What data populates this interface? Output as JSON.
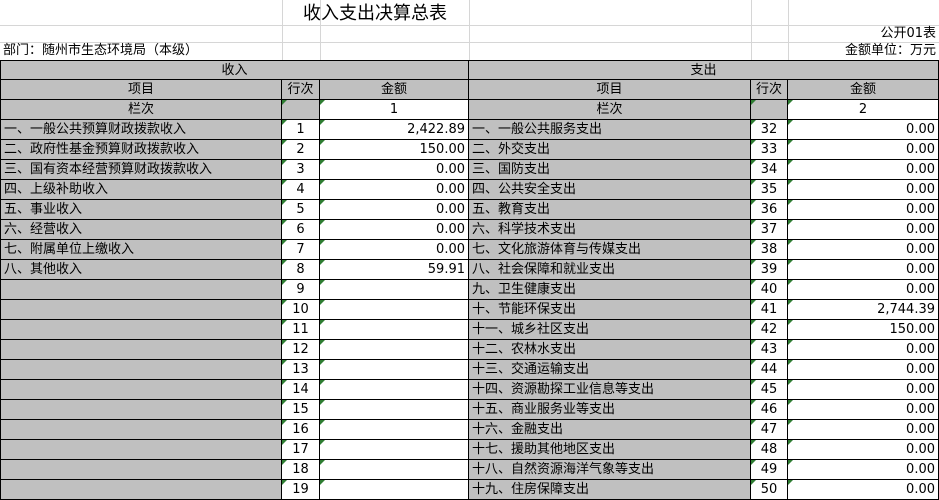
{
  "title": "收入支出决算总表",
  "form_no": "公开01表",
  "department": "部门：随州市生态环境局（本级）",
  "unit": "金额单位：万元",
  "income": {
    "header": "收入",
    "col_item": "项目",
    "col_row": "行次",
    "col_amount": "金额",
    "col_index_label": "栏次",
    "col_index_value": "1"
  },
  "expense": {
    "header": "支出",
    "col_item": "项目",
    "col_row": "行次",
    "col_amount": "金额",
    "col_index_label": "栏次",
    "col_index_value": "2"
  },
  "rows": [
    {
      "in_item": "一、一般公共预算财政拨款收入",
      "in_no": "1",
      "in_amt": "2,422.89",
      "ex_item": "一、一般公共服务支出",
      "ex_no": "32",
      "ex_amt": "0.00"
    },
    {
      "in_item": "二、政府性基金预算财政拨款收入",
      "in_no": "2",
      "in_amt": "150.00",
      "ex_item": "二、外交支出",
      "ex_no": "33",
      "ex_amt": "0.00"
    },
    {
      "in_item": "三、国有资本经营预算财政拨款收入",
      "in_no": "3",
      "in_amt": "0.00",
      "ex_item": "三、国防支出",
      "ex_no": "34",
      "ex_amt": "0.00"
    },
    {
      "in_item": "四、上级补助收入",
      "in_no": "4",
      "in_amt": "0.00",
      "ex_item": "四、公共安全支出",
      "ex_no": "35",
      "ex_amt": "0.00"
    },
    {
      "in_item": "五、事业收入",
      "in_no": "5",
      "in_amt": "0.00",
      "ex_item": "五、教育支出",
      "ex_no": "36",
      "ex_amt": "0.00"
    },
    {
      "in_item": "六、经营收入",
      "in_no": "6",
      "in_amt": "0.00",
      "ex_item": "六、科学技术支出",
      "ex_no": "37",
      "ex_amt": "0.00"
    },
    {
      "in_item": "七、附属单位上缴收入",
      "in_no": "7",
      "in_amt": "0.00",
      "ex_item": "七、文化旅游体育与传媒支出",
      "ex_no": "38",
      "ex_amt": "0.00"
    },
    {
      "in_item": "八、其他收入",
      "in_no": "8",
      "in_amt": "59.91",
      "ex_item": "八、社会保障和就业支出",
      "ex_no": "39",
      "ex_amt": "0.00"
    },
    {
      "in_item": "",
      "in_no": "9",
      "in_amt": "",
      "ex_item": "九、卫生健康支出",
      "ex_no": "40",
      "ex_amt": "0.00"
    },
    {
      "in_item": "",
      "in_no": "10",
      "in_amt": "",
      "ex_item": "十、节能环保支出",
      "ex_no": "41",
      "ex_amt": "2,744.39"
    },
    {
      "in_item": "",
      "in_no": "11",
      "in_amt": "",
      "ex_item": "十一、城乡社区支出",
      "ex_no": "42",
      "ex_amt": "150.00"
    },
    {
      "in_item": "",
      "in_no": "12",
      "in_amt": "",
      "ex_item": "十二、农林水支出",
      "ex_no": "43",
      "ex_amt": "0.00"
    },
    {
      "in_item": "",
      "in_no": "13",
      "in_amt": "",
      "ex_item": "十三、交通运输支出",
      "ex_no": "44",
      "ex_amt": "0.00"
    },
    {
      "in_item": "",
      "in_no": "14",
      "in_amt": "",
      "ex_item": "十四、资源勘探工业信息等支出",
      "ex_no": "45",
      "ex_amt": "0.00"
    },
    {
      "in_item": "",
      "in_no": "15",
      "in_amt": "",
      "ex_item": "十五、商业服务业等支出",
      "ex_no": "46",
      "ex_amt": "0.00"
    },
    {
      "in_item": "",
      "in_no": "16",
      "in_amt": "",
      "ex_item": "十六、金融支出",
      "ex_no": "47",
      "ex_amt": "0.00"
    },
    {
      "in_item": "",
      "in_no": "17",
      "in_amt": "",
      "ex_item": "十七、援助其他地区支出",
      "ex_no": "48",
      "ex_amt": "0.00"
    },
    {
      "in_item": "",
      "in_no": "18",
      "in_amt": "",
      "ex_item": "十八、自然资源海洋气象等支出",
      "ex_no": "49",
      "ex_amt": "0.00"
    },
    {
      "in_item": "",
      "in_no": "19",
      "in_amt": "",
      "ex_item": "十九、住房保障支出",
      "ex_no": "50",
      "ex_amt": "0.00"
    }
  ]
}
